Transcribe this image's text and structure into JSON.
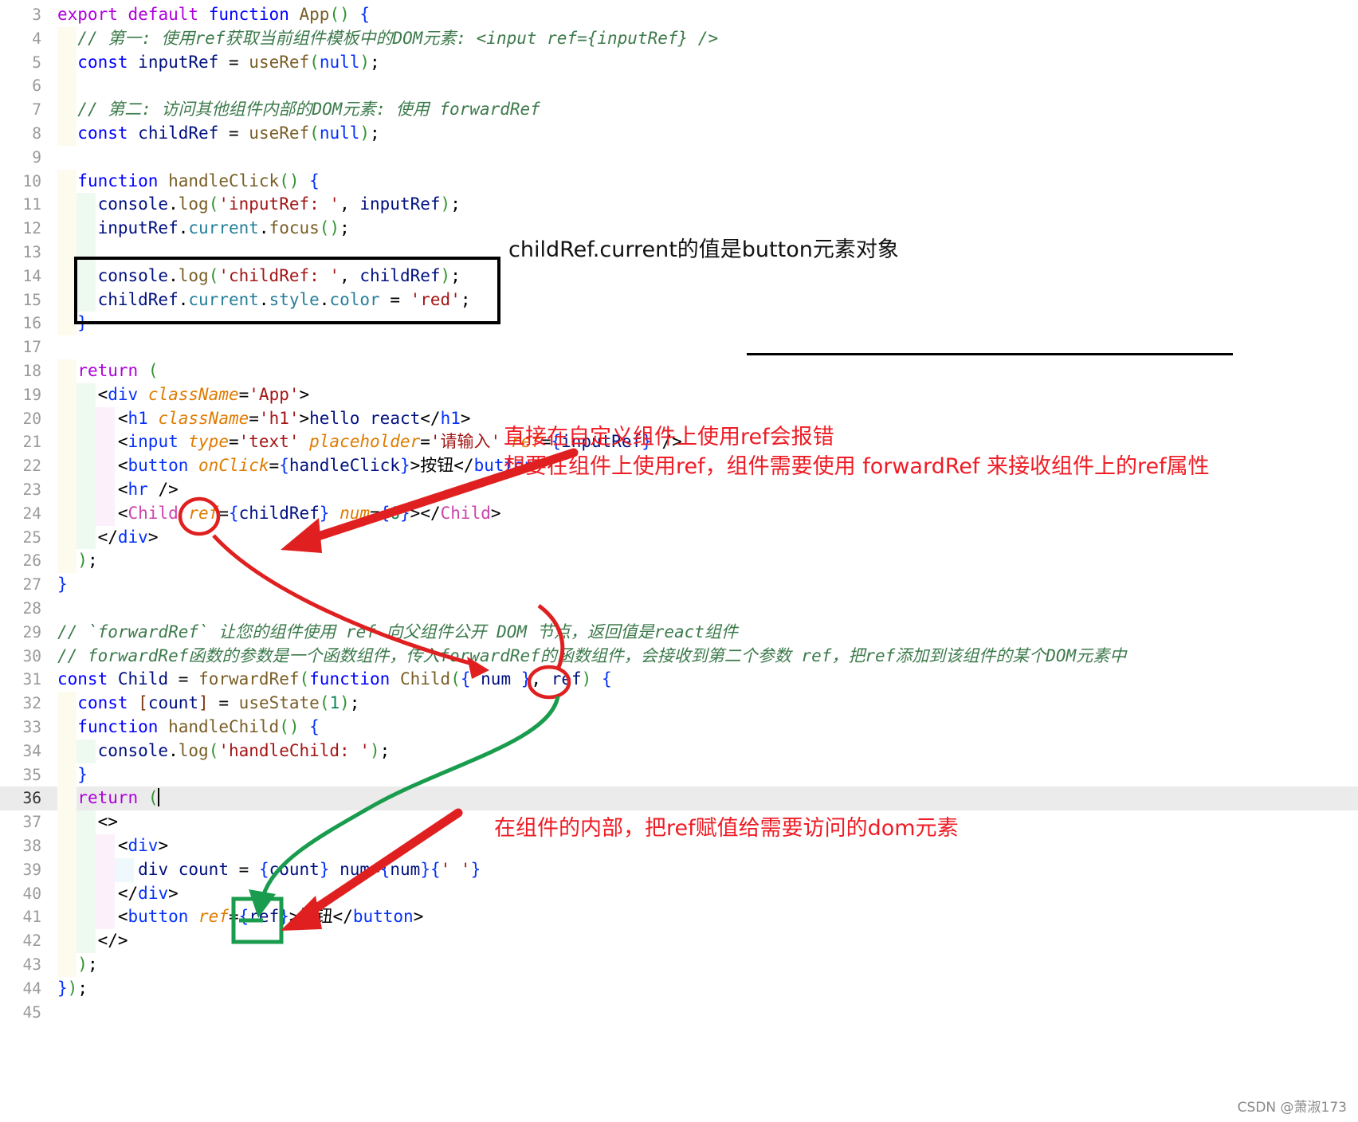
{
  "editor": {
    "language": "jsx",
    "current_line": 36,
    "first_line": 3,
    "last_line": 45,
    "lines": [
      {
        "n": 3,
        "indent": 0,
        "text": "export default function App() {"
      },
      {
        "n": 4,
        "indent": 1,
        "text": "// 第一: 使用ref获取当前组件模板中的DOM元素: <input ref={inputRef} />"
      },
      {
        "n": 5,
        "indent": 1,
        "text": "const inputRef = useRef(null);"
      },
      {
        "n": 6,
        "indent": 1,
        "text": ""
      },
      {
        "n": 7,
        "indent": 1,
        "text": "// 第二: 访问其他组件内部的DOM元素: 使用 forwardRef"
      },
      {
        "n": 8,
        "indent": 1,
        "text": "const childRef = useRef(null);"
      },
      {
        "n": 9,
        "indent": 0,
        "text": ""
      },
      {
        "n": 10,
        "indent": 1,
        "text": "function handleClick() {"
      },
      {
        "n": 11,
        "indent": 2,
        "text": "console.log('inputRef: ', inputRef);"
      },
      {
        "n": 12,
        "indent": 2,
        "text": "inputRef.current.focus();"
      },
      {
        "n": 13,
        "indent": 2,
        "text": ""
      },
      {
        "n": 14,
        "indent": 2,
        "text": "console.log('childRef: ', childRef);"
      },
      {
        "n": 15,
        "indent": 2,
        "text": "childRef.current.style.color = 'red';"
      },
      {
        "n": 16,
        "indent": 1,
        "text": "}"
      },
      {
        "n": 17,
        "indent": 0,
        "text": ""
      },
      {
        "n": 18,
        "indent": 1,
        "text": "return ("
      },
      {
        "n": 19,
        "indent": 2,
        "text": "<div className='App'>"
      },
      {
        "n": 20,
        "indent": 3,
        "text": "<h1 className='h1'>hello react</h1>"
      },
      {
        "n": 21,
        "indent": 3,
        "text": "<input type='text' placeholder='请输入' ref={inputRef} />"
      },
      {
        "n": 22,
        "indent": 3,
        "text": "<button onClick={handleClick}>按钮</button>"
      },
      {
        "n": 23,
        "indent": 3,
        "text": "<hr />"
      },
      {
        "n": 24,
        "indent": 3,
        "text": "<Child ref={childRef} num={6}></Child>"
      },
      {
        "n": 25,
        "indent": 2,
        "text": "</div>"
      },
      {
        "n": 26,
        "indent": 1,
        "text": ");"
      },
      {
        "n": 27,
        "indent": 0,
        "text": "}"
      },
      {
        "n": 28,
        "indent": 0,
        "text": ""
      },
      {
        "n": 29,
        "indent": 0,
        "text": "// `forwardRef` 让您的组件使用 ref 向父组件公开 DOM 节点，返回值是react组件"
      },
      {
        "n": 30,
        "indent": 0,
        "text": "// forwardRef函数的参数是一个函数组件，传入forwardRef的函数组件，会接收到第二个参数 ref，把ref添加到该组件的某个DOM元素中"
      },
      {
        "n": 31,
        "indent": 0,
        "text": "const Child = forwardRef(function Child({ num }, ref) {"
      },
      {
        "n": 32,
        "indent": 1,
        "text": "const [count] = useState(1);"
      },
      {
        "n": 33,
        "indent": 1,
        "text": "function handleChild() {"
      },
      {
        "n": 34,
        "indent": 2,
        "text": "console.log('handleChild: ');"
      },
      {
        "n": 35,
        "indent": 1,
        "text": "}"
      },
      {
        "n": 36,
        "indent": 1,
        "text": "return ("
      },
      {
        "n": 37,
        "indent": 2,
        "text": "<>"
      },
      {
        "n": 38,
        "indent": 3,
        "text": "<div>"
      },
      {
        "n": 39,
        "indent": 4,
        "text": "div count = {count} num={num}{' '}"
      },
      {
        "n": 40,
        "indent": 3,
        "text": "</div>"
      },
      {
        "n": 41,
        "indent": 3,
        "text": "<button ref={ref}>按钮</button>"
      },
      {
        "n": 42,
        "indent": 2,
        "text": "</>"
      },
      {
        "n": 43,
        "indent": 1,
        "text": ");"
      },
      {
        "n": 44,
        "indent": 0,
        "text": "});"
      },
      {
        "n": 45,
        "indent": 0,
        "text": ""
      }
    ]
  },
  "annotations": {
    "note_black_1": "childRef.current的值是button元素对象",
    "note_red_1": "直接在自定义组件上使用ref会报错",
    "note_red_2": "想要在组件上使用ref，组件需要使用 forwardRef 来接收组件上的ref属性",
    "note_red_3": "在组件的内部，把ref赋值给需要访问的dom元素"
  },
  "colors": {
    "red_annotation": "#ee1c25",
    "green_arrow": "#1a9c4e",
    "red_arrow": "#e02020",
    "black_box": "#000000",
    "comment_green": "#3c7a4b",
    "highlight_row": "#ebebeb"
  },
  "watermark": "CSDN @萧淑173"
}
